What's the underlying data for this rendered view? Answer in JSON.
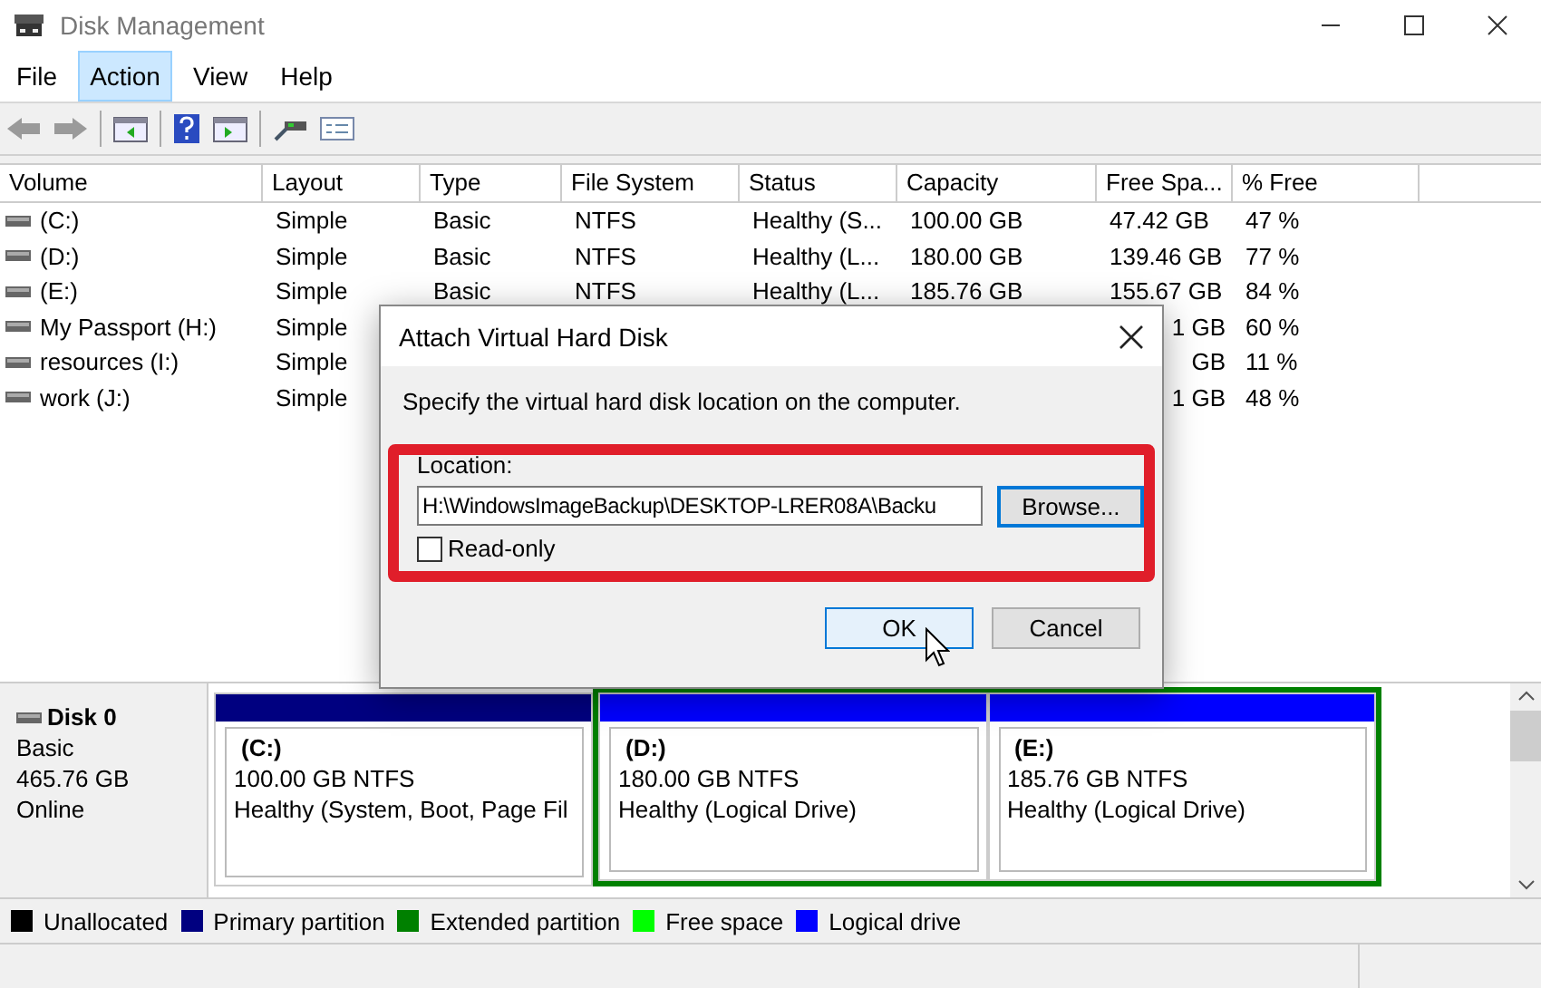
{
  "window": {
    "title": "Disk Management"
  },
  "menu": [
    {
      "label": "File",
      "selected": false
    },
    {
      "label": "Action",
      "selected": true
    },
    {
      "label": "View",
      "selected": false
    },
    {
      "label": "Help",
      "selected": false
    }
  ],
  "table": {
    "columns": [
      "Volume",
      "Layout",
      "Type",
      "File System",
      "Status",
      "Capacity",
      "Free Spa...",
      "% Free"
    ],
    "rows": [
      {
        "cells": [
          "(C:)",
          "Simple",
          "Basic",
          "NTFS",
          "Healthy (S...",
          "100.00 GB",
          "47.42 GB",
          "47 %"
        ]
      },
      {
        "cells": [
          "(D:)",
          "Simple",
          "Basic",
          "NTFS",
          "Healthy (L...",
          "180.00 GB",
          "139.46 GB",
          "77 %"
        ]
      },
      {
        "cells": [
          "(E:)",
          "Simple",
          "Basic",
          "NTFS",
          "Healthy (L...",
          "185.76 GB",
          "155.67 GB",
          "84 %"
        ]
      },
      {
        "cells": [
          "My Passport (H:)",
          "Simple",
          null,
          null,
          null,
          null,
          {
            "text": "1 GB",
            "cut": true
          },
          "60 %"
        ]
      },
      {
        "cells": [
          "resources (I:)",
          "Simple",
          null,
          null,
          null,
          null,
          {
            "text": "GB",
            "cut": true
          },
          "11 %"
        ]
      },
      {
        "cells": [
          "work (J:)",
          "Simple",
          null,
          null,
          null,
          null,
          {
            "text": "1 GB",
            "cut": true
          },
          "48 %"
        ]
      }
    ]
  },
  "disk": {
    "name": "Disk 0",
    "type": "Basic",
    "size": "465.76 GB",
    "status": "Online",
    "partitions": [
      {
        "kind": "primary",
        "label": "(C:)",
        "size": "100.00 GB NTFS",
        "status": "Healthy (System, Boot, Page Fil"
      },
      {
        "kind": "extended",
        "children": [
          {
            "kind": "logical",
            "label": "(D:)",
            "size": "180.00 GB NTFS",
            "status": "Healthy (Logical Drive)"
          },
          {
            "kind": "logical",
            "label": "(E:)",
            "size": "185.76 GB NTFS",
            "status": "Healthy (Logical Drive)"
          }
        ]
      }
    ]
  },
  "legend": [
    {
      "label": "Unallocated",
      "color": "#000000"
    },
    {
      "label": "Primary partition",
      "color": "#000080"
    },
    {
      "label": "Extended partition",
      "color": "#008000"
    },
    {
      "label": "Free space",
      "color": "#00ff00"
    },
    {
      "label": "Logical drive",
      "color": "#0000ff"
    }
  ],
  "dialog": {
    "title": "Attach Virtual Hard Disk",
    "message": "Specify the virtual hard disk location on the computer.",
    "location_label": "Location:",
    "location_value": "H:\\WindowsImageBackup\\DESKTOP-LRER08A\\Backu",
    "browse": "Browse...",
    "read_only": {
      "label": "Read-only",
      "checked": false
    },
    "ok": "OK",
    "cancel": "Cancel"
  }
}
